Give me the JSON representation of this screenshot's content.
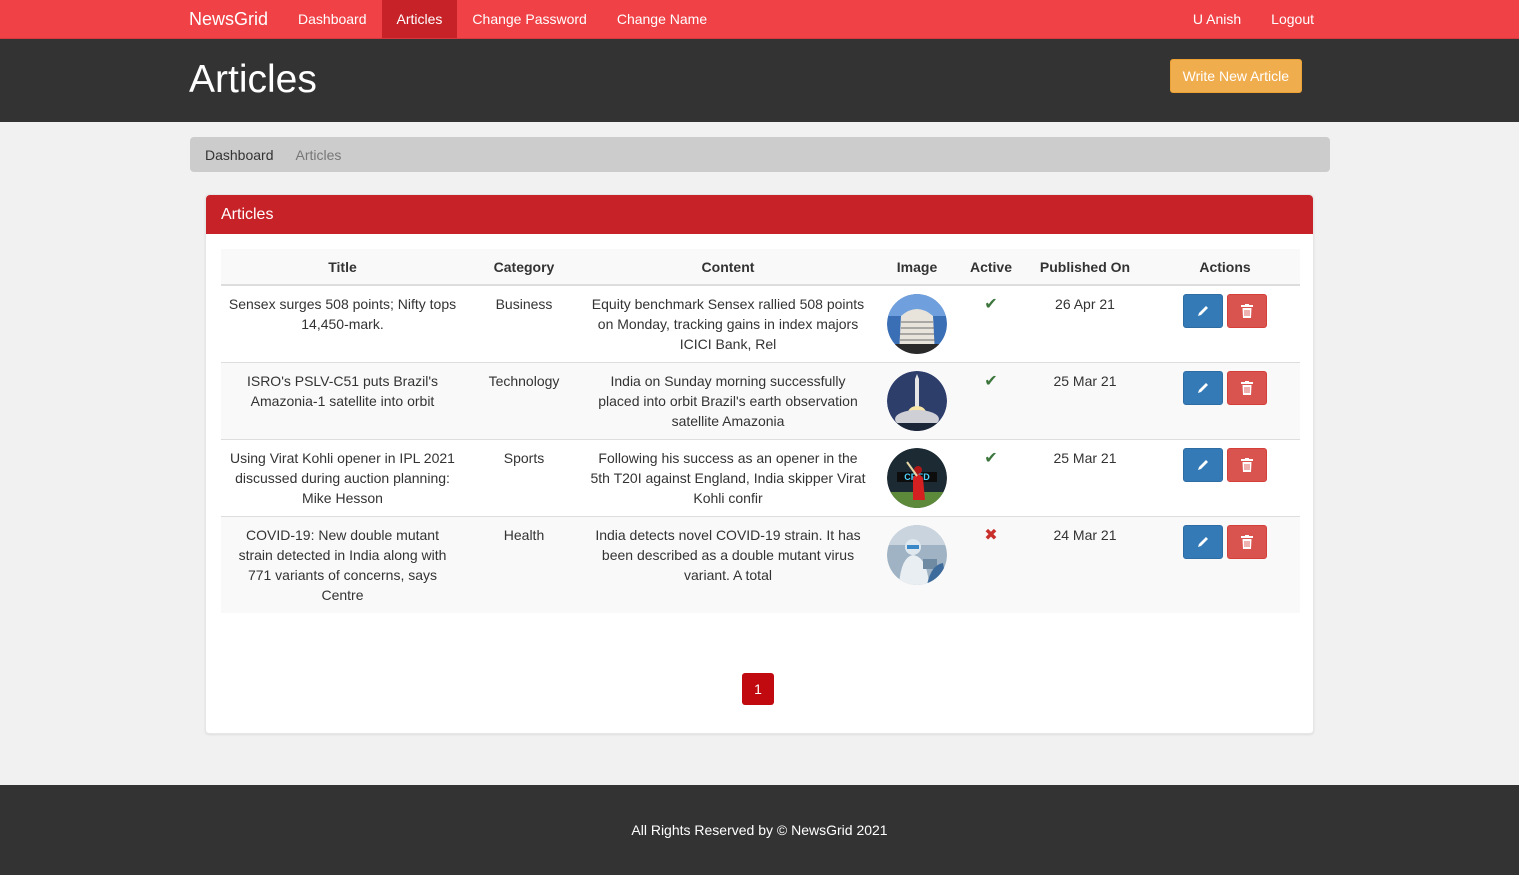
{
  "nav": {
    "brand": "NewsGrid",
    "links": [
      "Dashboard",
      "Articles",
      "Change Password",
      "Change Name"
    ],
    "active_index": 1,
    "user": "U Anish",
    "logout": "Logout"
  },
  "header": {
    "title": "Articles",
    "write_button": "Write New Article"
  },
  "breadcrumb": [
    "Dashboard",
    "Articles"
  ],
  "panel": {
    "title": "Articles",
    "columns": [
      "Title",
      "Category",
      "Content",
      "Image",
      "Active",
      "Published On",
      "Actions"
    ],
    "rows": [
      {
        "title": "Sensex surges 508 points; Nifty tops 14,450-mark.",
        "category": "Business",
        "content": "Equity benchmark Sensex rallied 508 points on Monday, tracking gains in index majors ICICI Bank, Rel",
        "image": "stock-exchange-building",
        "active": true,
        "published": "26 Apr 21"
      },
      {
        "title": "ISRO's PSLV-C51 puts Brazil's Amazonia-1 satellite into orbit",
        "category": "Technology",
        "content": "India on Sunday morning successfully placed into orbit Brazil's earth observation satellite Amazonia",
        "image": "rocket-launch",
        "active": true,
        "published": "25 Mar 21"
      },
      {
        "title": "Using Virat Kohli opener in IPL 2021 discussed during auction planning: Mike Hesson",
        "category": "Sports",
        "content": "Following his success as an opener in the 5th T20I against England, India skipper Virat Kohli confir",
        "image": "cricket-player",
        "active": true,
        "published": "25 Mar 21"
      },
      {
        "title": "COVID-19: New double mutant strain detected in India along with 771 variants of concerns, says Centre",
        "category": "Health",
        "content": "India detects novel COVID-19 strain. It has been described as a double mutant virus variant. A total",
        "image": "lab-worker",
        "active": false,
        "published": "24 Mar 21"
      }
    ]
  },
  "pagination": {
    "current": "1"
  },
  "footer": "All Rights Reserved by © NewsGrid 2021",
  "colors": {
    "nav": "#ef4146",
    "accent": "#c62228",
    "header": "#333333",
    "warning": "#f0ad4e",
    "primary": "#337ab7",
    "danger": "#d9534f"
  }
}
